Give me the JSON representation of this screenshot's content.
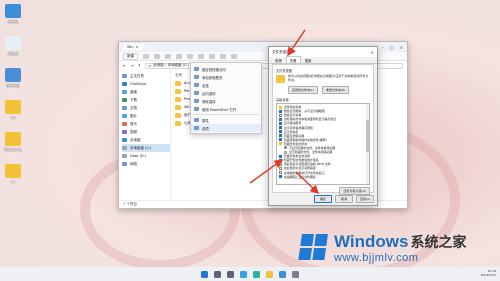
{
  "desktop": {
    "icons": [
      {
        "label": "此电脑",
        "icon": "monitor-icon",
        "color": "#3a8fd6"
      },
      {
        "label": "回收站",
        "icon": "recycle-bin-icon",
        "color": "#e8eef6"
      },
      {
        "label": "控制面板",
        "icon": "control-panel-icon",
        "color": "#4a90d9"
      },
      {
        "label": "DX",
        "icon": "folder-icon",
        "color": "#f2c23a"
      },
      {
        "label": "新建文件夹",
        "icon": "folder-icon",
        "color": "#f2c23a"
      },
      {
        "label": "xx",
        "icon": "folder-icon",
        "color": "#f2c23a"
      }
    ]
  },
  "explorer": {
    "tab_label": "Win",
    "new_button": "新建",
    "address": "此电脑 › 本地磁盘 (C:)",
    "nav": [
      {
        "label": "主文件夹",
        "color": "#6b9bd2"
      },
      {
        "label": "OneDrive",
        "color": "#2f7fd1"
      },
      {
        "label": "桌面",
        "color": "#5aa0e8"
      },
      {
        "label": "下载",
        "color": "#3b9c5a"
      },
      {
        "label": "文档",
        "color": "#6b9bd2"
      },
      {
        "label": "图片",
        "color": "#4aa3df"
      },
      {
        "label": "音乐",
        "color": "#e26b5a"
      },
      {
        "label": "视频",
        "color": "#8a6bd2"
      },
      {
        "label": "此电脑",
        "color": "#3a8fd6"
      },
      {
        "label": "本地磁盘 (C:)",
        "color": "#9aa4b0"
      },
      {
        "label": "Data (D:)",
        "color": "#9aa4b0"
      },
      {
        "label": "网络",
        "color": "#6b9bd2"
      }
    ],
    "content_header": "名称",
    "files": [
      "drivers",
      "PerfLogs",
      "Program Files",
      "Windows",
      "用户",
      "公用"
    ],
    "status": "7 个项目"
  },
  "context_menu": {
    "items": [
      {
        "label": "固定到快速访问"
      },
      {
        "label": "添加到收藏夹"
      },
      {
        "label": "全选"
      },
      {
        "label": "反向选择"
      },
      {
        "label": "清除选择"
      },
      {
        "label": "使用 PowerShell 打开"
      },
      {
        "label": "属性"
      },
      {
        "label": "选项"
      }
    ]
  },
  "dialog": {
    "title": "文件夹选项",
    "close": "×",
    "tabs": [
      "常规",
      "查看",
      "搜索"
    ],
    "group_view_label": "文件夹视图",
    "view_desc": "你可以将此视图(如详细信息或图标)应用于这种类型的所有文件夹。",
    "apply_btn": "应用到文件夹(L)",
    "reset_btn": "重置文件夹(R)",
    "group_adv_label": "高级设置:",
    "advanced": [
      {
        "label": "文件和文件夹",
        "type": "none",
        "on": false
      },
      {
        "label": "始终显示图标，从不显示缩略图",
        "type": "check",
        "on": true
      },
      {
        "label": "始终显示菜单",
        "type": "check",
        "on": false
      },
      {
        "label": "鼠标指向文件夹和桌面项时显示提示信息",
        "type": "check",
        "on": true
      },
      {
        "label": "显示驱动器号",
        "type": "check",
        "on": true
      },
      {
        "label": "显示同步提供程序通知",
        "type": "check",
        "on": true
      },
      {
        "label": "显示状态栏",
        "type": "check",
        "on": true
      },
      {
        "label": "隐藏空的驱动器",
        "type": "check",
        "on": true
      },
      {
        "label": "隐藏受保护的操作系统文件(推荐)",
        "type": "check",
        "on": true
      },
      {
        "label": "隐藏文件和文件夹",
        "type": "none",
        "on": false
      },
      {
        "label": "不显示隐藏的文件、文件夹或驱动器",
        "type": "radio",
        "on": true
      },
      {
        "label": "显示隐藏的文件、文件夹和驱动器",
        "type": "radio",
        "on": false
      },
      {
        "label": "隐藏文件夹合并冲突",
        "type": "check",
        "on": true
      },
      {
        "label": "隐藏已知文件类型的扩展名",
        "type": "check",
        "on": true
      },
      {
        "label": "用彩色显示加密或压缩的 NTFS 文件",
        "type": "check",
        "on": false
      },
      {
        "label": "在标题栏中显示完整路径",
        "type": "check",
        "on": false
      },
      {
        "label": "在单独的进程中打开文件夹窗口",
        "type": "check",
        "on": false
      },
      {
        "label": "在缩略图上显示文件图标",
        "type": "check",
        "on": true
      }
    ],
    "restore_btn": "还原为默认值(D)",
    "ok": "确定",
    "cancel": "取消",
    "apply": "应用(A)"
  },
  "taskbar": {
    "icons": [
      {
        "name": "start-icon",
        "color": "#1f7ad6"
      },
      {
        "name": "search-icon",
        "color": "#5b6470"
      },
      {
        "name": "taskview-icon",
        "color": "#5b6470"
      },
      {
        "name": "widgets-icon",
        "color": "#3aa0e6"
      },
      {
        "name": "edge-icon",
        "color": "#2fb3a0"
      },
      {
        "name": "explorer-icon",
        "color": "#f2c23a"
      },
      {
        "name": "store-icon",
        "color": "#3a8fd6"
      },
      {
        "name": "settings-icon",
        "color": "#7a7f88"
      }
    ],
    "time": "10:18",
    "date": "2023/5/31"
  },
  "watermark": {
    "brand": "Windows",
    "brand_cn": "系统之家",
    "url": "www.bjjmlv.com",
    "logo_color": "#1f7ad6"
  },
  "annotation_color": "#e03a2a"
}
